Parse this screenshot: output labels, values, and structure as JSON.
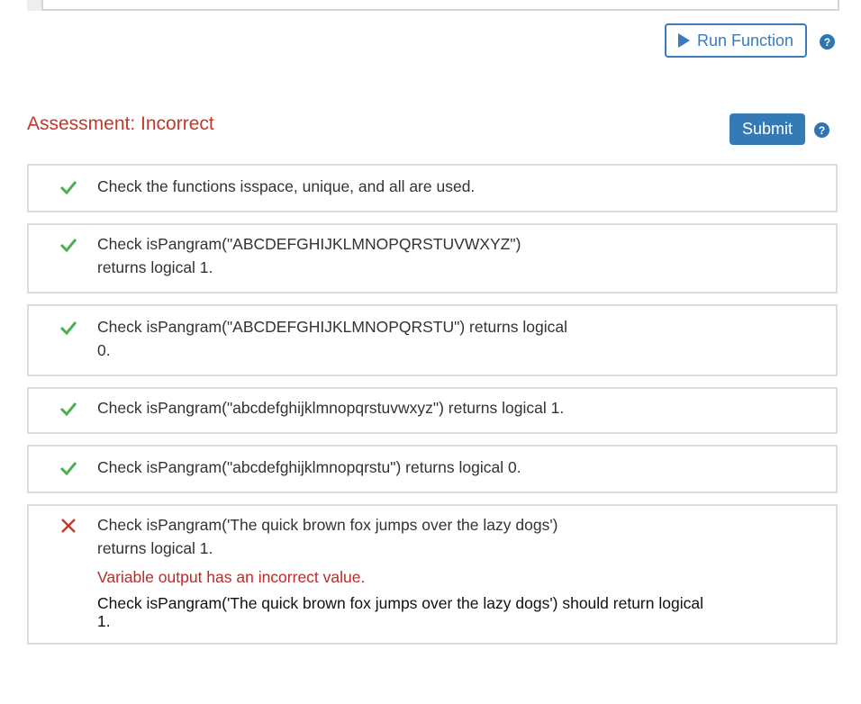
{
  "toolbar": {
    "run_label": "Run Function"
  },
  "assessment": {
    "title": "Assessment: Incorrect",
    "submit_label": "Submit"
  },
  "checks": [
    {
      "status": "pass",
      "lines": [
        "Check the functions isspace, unique, and all are used."
      ]
    },
    {
      "status": "pass",
      "lines": [
        "Check isPangram(\"ABCDEFGHIJKLMNOPQRSTUVWXYZ\")",
        "returns logical 1."
      ]
    },
    {
      "status": "pass",
      "lines": [
        "Check isPangram(\"ABCDEFGHIJKLMNOPQRSTU\") returns logical",
        "0."
      ]
    },
    {
      "status": "pass",
      "lines": [
        "Check isPangram(\"abcdefghijklmnopqrstuvwxyz\") returns logical 1."
      ]
    },
    {
      "status": "pass",
      "lines": [
        "Check isPangram(\"abcdefghijklmnopqrstu\") returns logical 0."
      ]
    },
    {
      "status": "fail",
      "lines": [
        "Check isPangram('The quick brown fox jumps over the lazy dogs')",
        "returns logical 1."
      ],
      "error": "Variable output has an incorrect value.",
      "detail": [
        "Check isPangram('The quick brown fox jumps over the lazy dogs') should return logical",
        "1."
      ]
    }
  ],
  "colors": {
    "pass": "#4caf50",
    "fail": "#c0392b",
    "accent": "#337ab7"
  },
  "icons": {
    "run": "play-icon",
    "help": "question-circle-icon",
    "pass": "check-icon",
    "fail": "x-icon"
  }
}
